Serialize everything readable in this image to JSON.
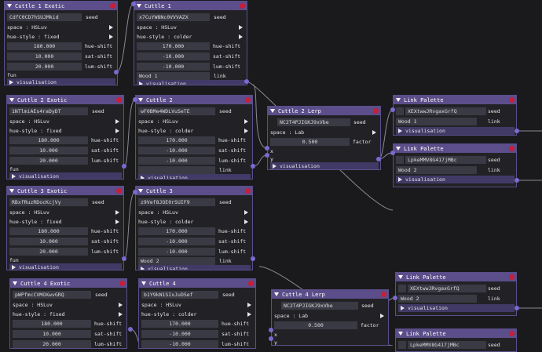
{
  "exotic_nodes": [
    {
      "title": "Cuttle 1 Exotic",
      "seed": "CdfC0CD7hSUJMkid",
      "space": "space : HSLuv",
      "hue_style": "hue-style : fixed",
      "hue_shift": "180.000",
      "sat_shift": "10.000",
      "lum_shift": "20.000",
      "fun": "fun",
      "vis": "visualisation"
    },
    {
      "title": "Cuttle 2 Exotic",
      "seed": "1NTlmiAEs4raDyDT",
      "space": "space : HSLuv",
      "hue_style": "hue-style : fixed",
      "hue_shift": "180.000",
      "sat_shift": "10.000",
      "lum_shift": "20.000",
      "fun": "fun",
      "vis": "visualisation"
    },
    {
      "title": "Cuttle 3 Exotic",
      "seed": "RBxfRuzRDocKcjVy",
      "space": "space : HSLuv",
      "hue_style": "hue-style : fixed",
      "hue_shift": "180.000",
      "sat_shift": "10.000",
      "lum_shift": "20.000",
      "fun": "fun",
      "vis": "visualisation"
    },
    {
      "title": "Cuttle 4 Exotic",
      "seed": "pWPfmcCVMOXwvGRQ",
      "space": "space : HSLuv",
      "hue_style": "hue-style : fixed",
      "hue_shift": "180.000",
      "sat_shift": "10.000",
      "lum_shift": "20.000",
      "fun": "fun",
      "vis": "visualisation"
    }
  ],
  "cuttle_nodes": [
    {
      "title": "Cuttle 1",
      "seed": "x7CuYW8Nc0VVVAZX",
      "space": "space : HSLuv",
      "hue_style": "hue-style : colder",
      "hue_shift": "170.000",
      "sat_shift": "-10.000",
      "lum_shift": "-10.000",
      "link_value": "Wood 1",
      "vis": "visualisation"
    },
    {
      "title": "Cuttle 2",
      "seed": "wF0BMe4WDLVuSeTE",
      "space": "space : HSLuv",
      "hue_style": "hue-style : colder",
      "hue_shift": "170.000",
      "sat_shift": "-10.000",
      "lum_shift": "-10.000",
      "link_value": "",
      "vis": "visualisation"
    },
    {
      "title": "Cuttle 3",
      "seed": "z9Vef8JOE0rSUIF9",
      "space": "space : HSLuv",
      "hue_style": "hue-style : colder",
      "hue_shift": "170.000",
      "sat_shift": "-10.000",
      "lum_shift": "-10.000",
      "link_value": "Wood 2",
      "vis": "visualisation"
    },
    {
      "title": "Cuttle 4",
      "seed": "b1Y9kN1SIxJuDSef",
      "space": "space : HSLuv",
      "hue_style": "hue-style : colder",
      "hue_shift": "170.000",
      "sat_shift": "-10.000",
      "lum_shift": "-10.000",
      "link_value": "",
      "vis": "visualisation"
    }
  ],
  "lerp_nodes": [
    {
      "title": "Cuttle 2 Lerp",
      "seed": "NC2T4PJIGKJ9xVbe",
      "space": "space : Lab",
      "factor": "0.500",
      "x": "x",
      "y": "y",
      "vis": "visualisation"
    },
    {
      "title": "Cuttle 4 Lerp",
      "seed": "NC2T4PJIGKJ9xVbe",
      "space": "space : Lab",
      "factor": "0.500",
      "x": "x",
      "y": "y",
      "vis": "visualisation"
    }
  ],
  "palette_nodes": [
    {
      "title": "Link Palette",
      "seed": "XEXtwwJRvgaxGrfQ",
      "link_value": "Wood 1",
      "vis": "visualisation"
    },
    {
      "title": "Link Palette",
      "seed": "LpkeMMV8G417jMBc",
      "link_value": "Wood 2",
      "vis": "visualisation"
    },
    {
      "title": "Link Palette",
      "seed": "XEXtwwJRvgaxGrfQ",
      "link_value": "Wood 2",
      "vis": "visualisation"
    },
    {
      "title": "Link Palette",
      "seed": "LpkeMMV8G417jMBc",
      "link_value": "",
      "vis": "visualisation"
    }
  ],
  "labels": {
    "seed": "seed",
    "hue_shift": "hue-shift",
    "sat_shift": "sat-shift",
    "lum_shift": "lum-shift",
    "link": "link",
    "factor": "factor"
  },
  "colors": {
    "title_bar": "#5b4e8a",
    "panel": "#222226",
    "field": "#3a3a44",
    "close": "#c81e3a",
    "pin": "#7a6ad0",
    "wire": "#8a8a90"
  }
}
